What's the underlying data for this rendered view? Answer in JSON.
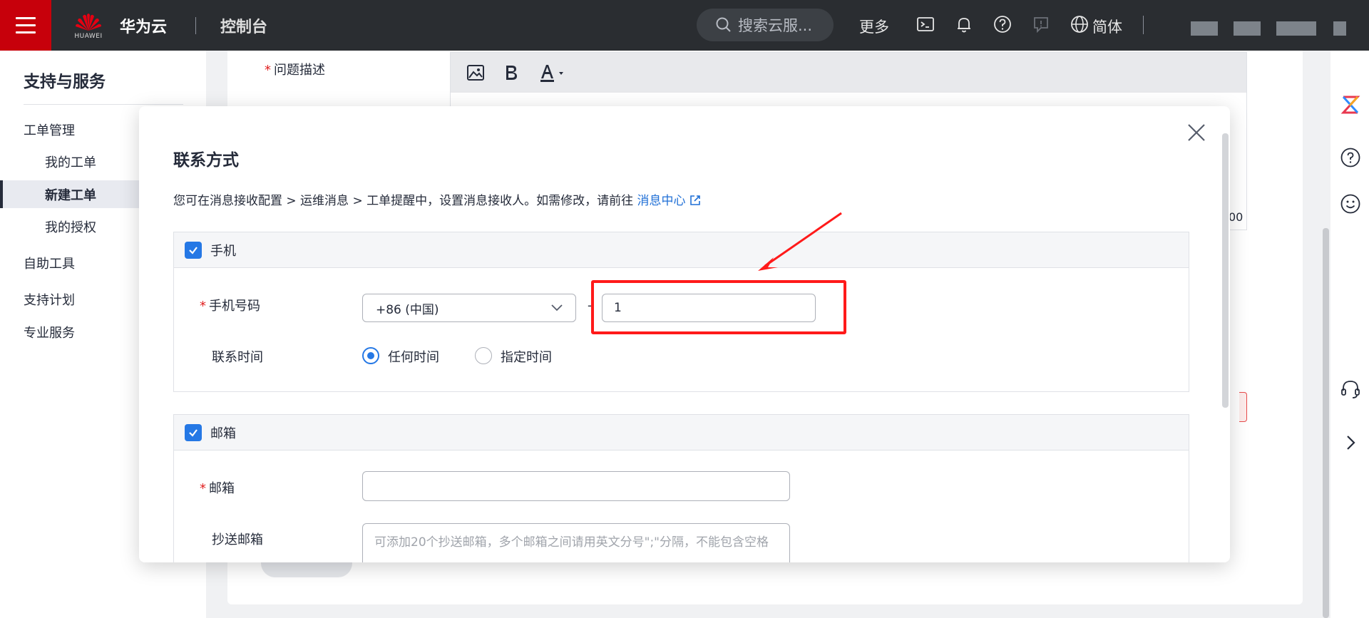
{
  "topbar": {
    "brand": "华为云",
    "logo_text": "HUAWEI",
    "console": "控制台",
    "search_placeholder": "搜索云服...",
    "more": "更多",
    "language": "简体",
    "brand_color": "#c7000b"
  },
  "sidebar": {
    "title": "支持与服务",
    "groups": [
      {
        "label": "工单管理",
        "children": [
          "我的工单",
          "新建工单",
          "我的授权"
        ]
      },
      {
        "label": "自助工具"
      },
      {
        "label": "支持计划"
      },
      {
        "label": "专业服务"
      }
    ],
    "active": "新建工单"
  },
  "background": {
    "field_label": "问题描述",
    "counter_tail": "00"
  },
  "modal": {
    "title": "联系方式",
    "desc": "您可在消息接收配置 > 运维消息 > 工单提醒中，设置消息接收人。如需修改，请前往 ",
    "desc_link": "消息中心",
    "phone_section": {
      "head": "手机",
      "phone_label": "手机号码",
      "country_code": "+86 (中国)",
      "dash": "-",
      "phone_value": "1",
      "time_label": "联系时间",
      "time_options": [
        "任何时间",
        "指定时间"
      ],
      "time_selected": "任何时间"
    },
    "email_section": {
      "head": "邮箱",
      "email_label": "邮箱",
      "cc_label": "抄送邮箱",
      "cc_placeholder": "可添加20个抄送邮箱，多个邮箱之间请用英文分号\";\"分隔，不能包含空格"
    }
  },
  "colors": {
    "accent": "#2578e5",
    "highlight": "#ff1a1a",
    "link": "#1f6fd6"
  }
}
